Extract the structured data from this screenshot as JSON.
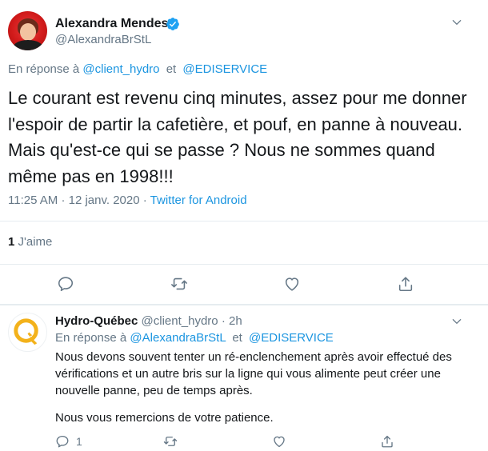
{
  "main_tweet": {
    "author_name": "Alexandra Mendes",
    "author_handle": "@AlexandraBrStL",
    "reply_prefix": "En réponse à",
    "reply_mention_1": "@client_hydro",
    "reply_and": "et",
    "reply_mention_2": "@EDISERVICE",
    "text": "Le courant est revenu cinq minutes, assez pour me donner l'espoir de partir la cafetière, et pouf, en panne à nouveau. Mais qu'est-ce qui se passe ? Nous ne sommes quand même pas en 1998!!!",
    "time": "11:25 AM",
    "date": "12 janv. 2020",
    "separator": "·",
    "source": "Twitter for Android",
    "likes_count": "1",
    "likes_label": "J'aime"
  },
  "reply_tweet": {
    "author_name": "Hydro-Québec",
    "author_handle": "@client_hydro",
    "separator": "·",
    "age": "2h",
    "reply_prefix": "En réponse à",
    "reply_mention_1": "@AlexandraBrStL",
    "reply_and": "et",
    "reply_mention_2": "@EDISERVICE",
    "text_1": "Nous devons souvent tenter un ré-enclenchement après avoir effectué des vérifications et un autre bris sur la ligne qui vous alimente peut créer une nouvelle panne, peu de temps après.",
    "text_2": "Nous vous remercions de votre patience.",
    "reply_count": "1"
  },
  "icons": {
    "verified": "verified-badge-icon",
    "more": "chevron-down-icon",
    "reply": "reply-icon",
    "retweet": "retweet-icon",
    "like": "heart-icon",
    "share": "share-icon",
    "hq_logo": "hydro-quebec-logo"
  },
  "colors": {
    "link": "#1b95e0",
    "muted": "#657786",
    "text": "#14171a",
    "divider": "#e6ecf0",
    "brand_hq": "#f3b21b"
  }
}
